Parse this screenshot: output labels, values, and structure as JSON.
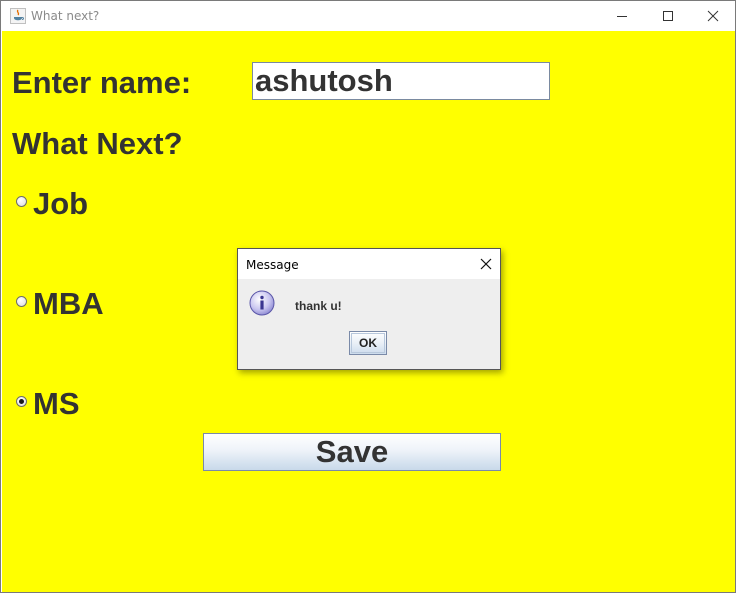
{
  "window": {
    "title": "What next?",
    "icon": "java-cup-icon",
    "controls": [
      "minimize-icon",
      "maximize-icon",
      "close-icon"
    ]
  },
  "form": {
    "name_label": "Enter name:",
    "name_value": "ashutosh",
    "question_label": "What Next?",
    "options": [
      {
        "label": "Job",
        "selected": false
      },
      {
        "label": "MBA",
        "selected": false
      },
      {
        "label": "MS",
        "selected": true
      }
    ],
    "save_label": "Save",
    "background_color": "#ffff00"
  },
  "dialog": {
    "title": "Message",
    "message": "thank u!",
    "icon": "info-icon",
    "ok_label": "OK"
  }
}
